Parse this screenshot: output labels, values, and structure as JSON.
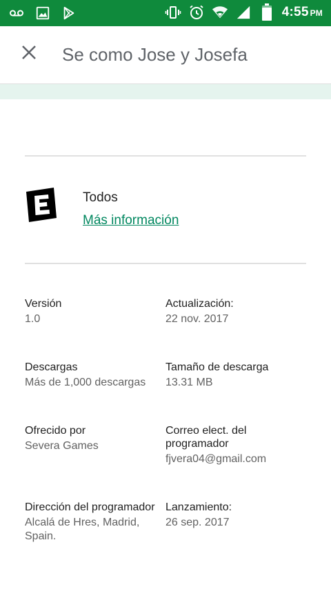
{
  "status_bar": {
    "icons_left": [
      "voicemail-icon",
      "image-icon",
      "play-store-icon"
    ],
    "icons_right": [
      "vibrate-icon",
      "alarm-icon",
      "wifi-icon",
      "signal-icon",
      "battery-icon"
    ],
    "time": "4:55",
    "ampm": "PM",
    "color": "#0f8a3c"
  },
  "header": {
    "title": "Se como Jose y Josefa",
    "close_icon": "close-icon"
  },
  "rating": {
    "icon": "esrb-e-icon",
    "label": "Todos",
    "link": "Más información",
    "link_color": "#01875f"
  },
  "info": {
    "version": {
      "label": "Versión",
      "value": "1.0"
    },
    "updated": {
      "label": "Actualización:",
      "value": "22 nov. 2017"
    },
    "downloads": {
      "label": "Descargas",
      "value": "Más de 1,000 descargas"
    },
    "size": {
      "label": "Tamaño de descarga",
      "value": "13.31 MB"
    },
    "offered_by": {
      "label": "Ofrecido por",
      "value": "Severa Games"
    },
    "email": {
      "label_line1": "Correo elect. del",
      "label_line2": "programador",
      "value": "fjvera04@gmail.com"
    },
    "address": {
      "label": "Dirección del programador",
      "value_line1": "Alcalá de Hres, Madrid,",
      "value_line2": "Spain."
    },
    "released": {
      "label": "Lanzamiento:",
      "value": "26 sep. 2017"
    }
  }
}
